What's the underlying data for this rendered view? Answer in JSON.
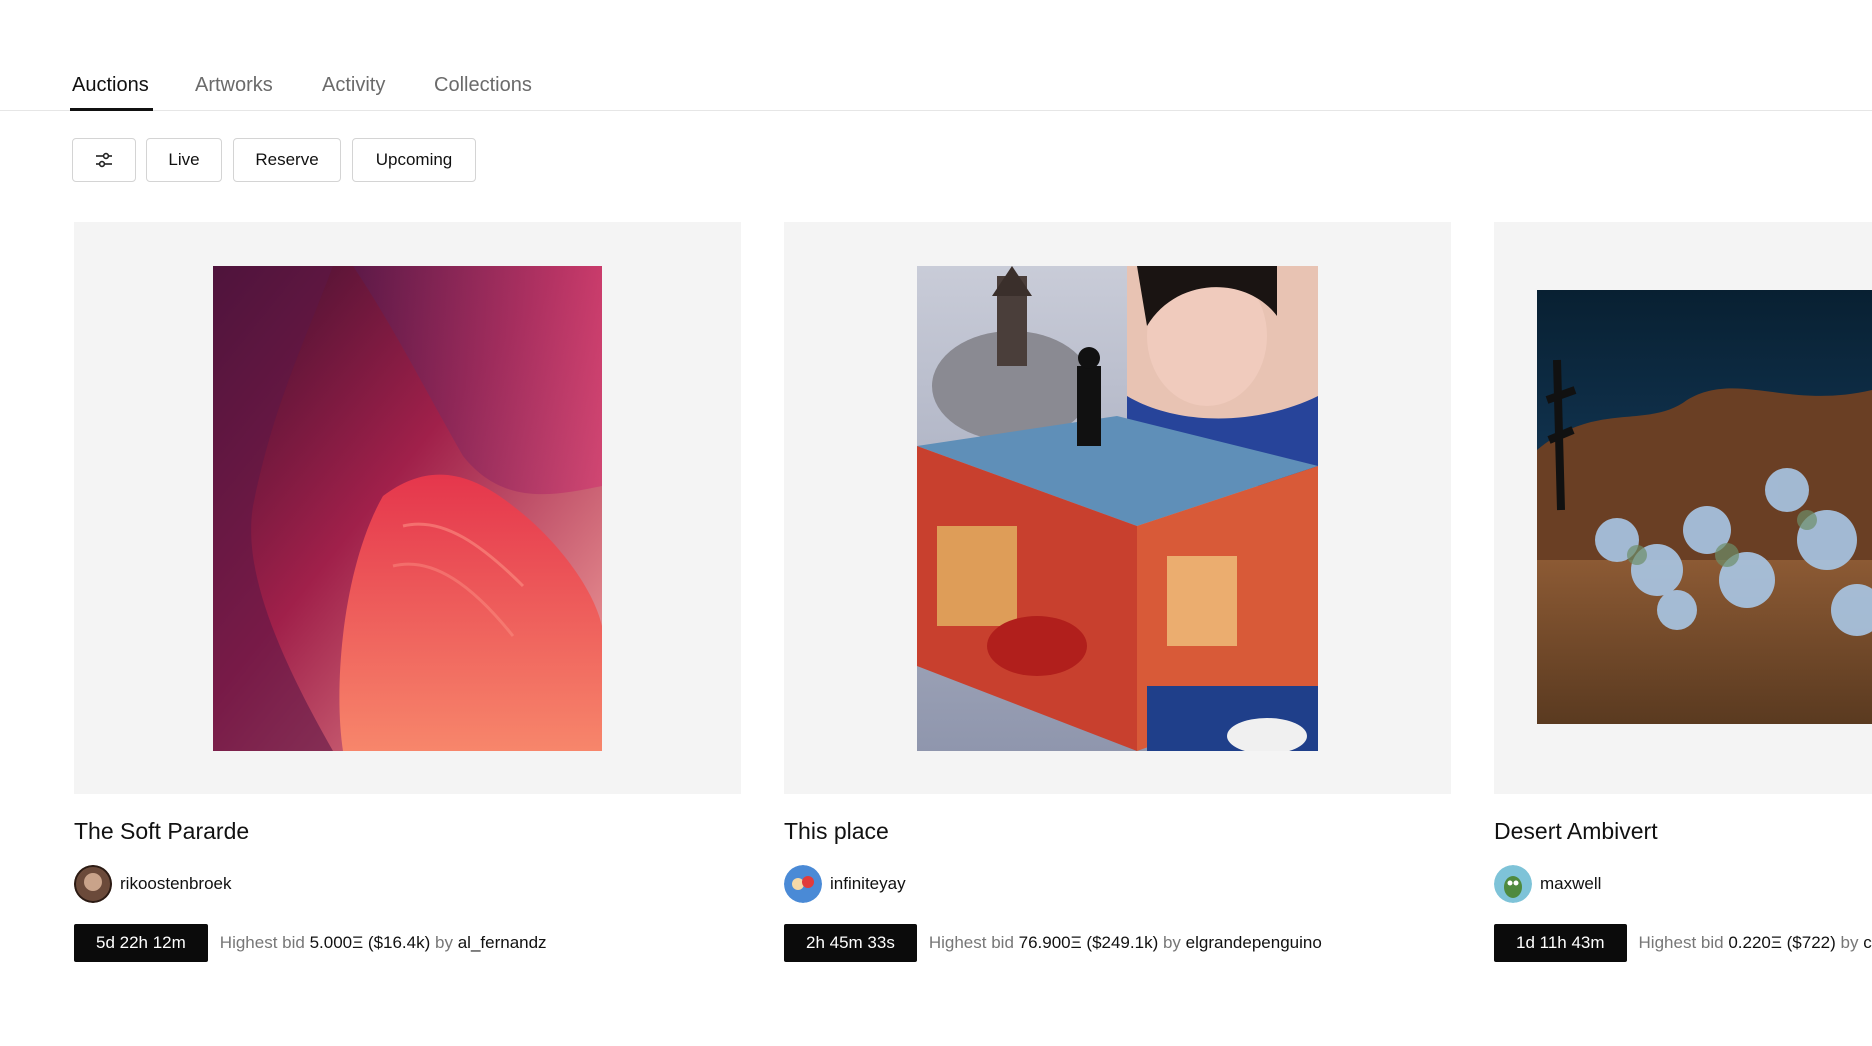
{
  "tabs": [
    {
      "label": "Auctions",
      "active": true
    },
    {
      "label": "Artworks",
      "active": false
    },
    {
      "label": "Activity",
      "active": false
    },
    {
      "label": "Collections",
      "active": false
    }
  ],
  "filters": {
    "settings_icon": "sliders-icon",
    "options": [
      "Live",
      "Reserve",
      "Upcoming"
    ]
  },
  "auctions": [
    {
      "title": "The Soft Pararde",
      "creator": "rikoostenbroek",
      "timer": "5d 22h 12m",
      "bid_prefix": "Highest bid",
      "bid_amount": "5.000Ξ ($16.4k)",
      "bid_by": "by",
      "bidder": "al_fernandz"
    },
    {
      "title": "This place",
      "creator": "infiniteyay",
      "timer": "2h 45m 33s",
      "bid_prefix": "Highest bid",
      "bid_amount": "76.900Ξ ($249.1k)",
      "bid_by": "by",
      "bidder": "elgrandepenguino"
    },
    {
      "title": "Desert Ambivert",
      "creator": "maxwell",
      "timer": "1d 11h 43m",
      "bid_prefix": "Highest bid",
      "bid_amount": "0.220Ξ ($722)",
      "bid_by": "by",
      "bidder": "c"
    }
  ]
}
